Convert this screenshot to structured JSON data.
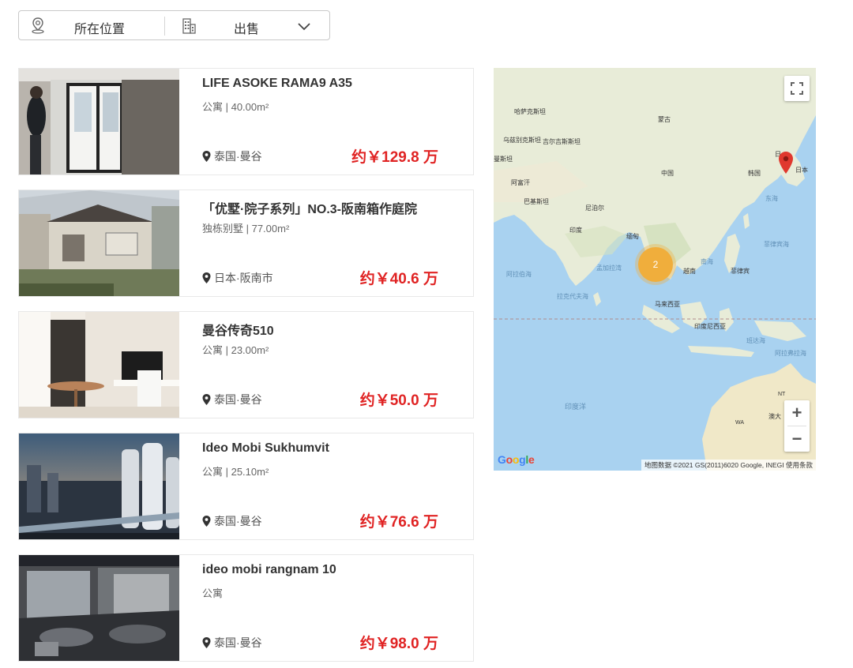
{
  "filter": {
    "location_label": "所在位置",
    "type_label": "出售"
  },
  "listings": [
    {
      "title": "LIFE ASOKE RAMA9 A35",
      "meta": "公寓 | 40.00m²",
      "location": "泰国·曼谷",
      "price": "约￥129.8 万"
    },
    {
      "title": "「优墅·院子系列」NO.3-阪南箱作庭院",
      "meta": "独栋别墅 | 77.00m²",
      "location": "日本·阪南市",
      "price": "约￥40.6 万"
    },
    {
      "title": "曼谷传奇510",
      "meta": "公寓 | 23.00m²",
      "location": "泰国·曼谷",
      "price": "约￥50.0 万"
    },
    {
      "title": "Ideo Mobi Sukhumvit",
      "meta": "公寓 | 25.10m²",
      "location": "泰国·曼谷",
      "price": "约￥76.6 万"
    },
    {
      "title": "ideo mobi rangnam 10",
      "meta": "公寓",
      "location": "泰国·曼谷",
      "price": "约￥98.0 万"
    }
  ],
  "map": {
    "labels": {
      "kazakhstan": "哈萨克斯坦",
      "mongolia": "蒙古",
      "uzbekistan": "乌兹别克斯坦",
      "kyrgyzstan": "吉尔吉斯斯坦",
      "turkmenistan": "曼斯坦",
      "afghanistan": "阿富汗",
      "pakistan": "巴基斯坦",
      "china": "中国",
      "nepal": "尼泊尔",
      "india": "印度",
      "myanmar": "缅甸",
      "japan_top": "日",
      "korea": "韩国",
      "japan": "日本",
      "east_sea": "东海",
      "south_sea": "南海",
      "philippine_sea": "菲律宾海",
      "arabian_sea": "阿拉伯海",
      "bengal_bay": "孟加拉湾",
      "vietnam": "越南",
      "philippines": "菲律宾",
      "laccadive_sea": "拉克代夫海",
      "malaysia": "马来西亚",
      "indonesia": "印度尼西亚",
      "banda_sea": "班达海",
      "arafura_sea": "阿拉弗拉海",
      "indian_ocean": "印度洋",
      "nt": "NT",
      "wa": "WA",
      "australia": "澳大"
    },
    "cluster_count": "2",
    "google": "Google",
    "attribution": "地图数据 ©2021 GS(2011)6020 Google, INEGI   使用条款",
    "zoom_in": "+",
    "zoom_out": "−",
    "colors": {
      "water": "#a9d2f0",
      "land": "#e8ecd8",
      "cluster": "#f0ae3c",
      "marker": "#e0382e"
    }
  }
}
